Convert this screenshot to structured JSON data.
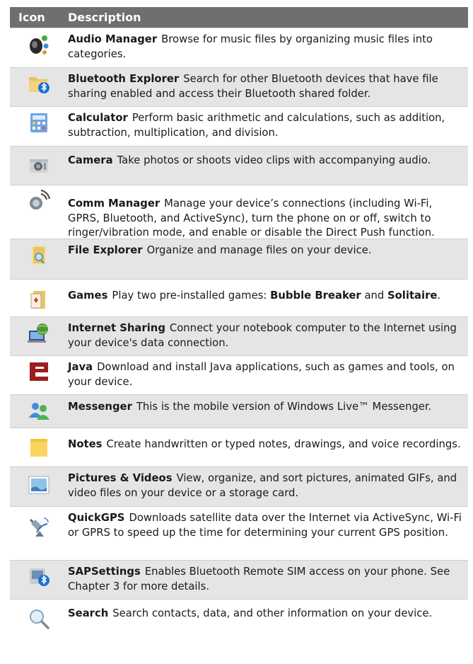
{
  "header": {
    "icon_col": "Icon",
    "desc_col": "Description"
  },
  "rows": [
    {
      "icon": "audio-manager-icon",
      "name": "Audio Manager",
      "desc": "Browse for music files by organizing music files into categories."
    },
    {
      "icon": "bluetooth-explorer-icon",
      "name": "Bluetooth Explorer",
      "desc": "Search for other Bluetooth devices that have file sharing enabled and access their Bluetooth shared folder."
    },
    {
      "icon": "calculator-icon",
      "name": "Calculator",
      "desc": "Perform basic arithmetic and calculations, such as addition, subtraction, multiplication, and division."
    },
    {
      "icon": "camera-icon",
      "name": "Camera",
      "desc": "Take photos or shoots video clips with accompanying audio."
    },
    {
      "icon": "comm-manager-icon",
      "name": "Comm Manager",
      "desc": "Manage your device’s connections (including Wi-Fi, GPRS, Bluetooth, and ActiveSync), turn the phone on or off, switch to ringer/vibration mode, and enable or disable the Direct Push function."
    },
    {
      "icon": "file-explorer-icon",
      "name": "File Explorer",
      "desc": "Organize and manage files on your device."
    },
    {
      "icon": "games-icon",
      "name": "Games",
      "desc_pre": "Play two pre-installed games: ",
      "game1": "Bubble Breaker",
      "desc_mid": " and ",
      "game2": "Solitaire",
      "desc_post": "."
    },
    {
      "icon": "internet-sharing-icon",
      "name": "Internet Sharing",
      "desc": "Connect your notebook computer to the Internet using your device's data connection."
    },
    {
      "icon": "java-icon",
      "name": "Java",
      "desc": "Download and install Java applications, such as games and tools, on your device."
    },
    {
      "icon": "messenger-icon",
      "name": "Messenger",
      "desc": "This is the mobile version of Windows Live™ Messenger."
    },
    {
      "icon": "notes-icon",
      "name": "Notes",
      "desc": "Create handwritten or typed notes, drawings, and voice recordings."
    },
    {
      "icon": "pictures-videos-icon",
      "name": "Pictures & Videos",
      "desc": "View, organize, and sort pictures, animated GIFs, and video files on your device or a storage card."
    },
    {
      "icon": "quickgps-icon",
      "name": "QuickGPS",
      "desc": "Downloads satellite data over the Internet via ActiveSync, Wi-Fi or GPRS to speed up the time for determining your current GPS position."
    },
    {
      "icon": "sapsettings-icon",
      "name": "SAPSettings",
      "desc": "Enables Bluetooth Remote SIM access on your phone. See Chapter 3 for more details."
    },
    {
      "icon": "search-icon",
      "name": "Search",
      "desc": "Search contacts, data, and other information on your device."
    }
  ]
}
